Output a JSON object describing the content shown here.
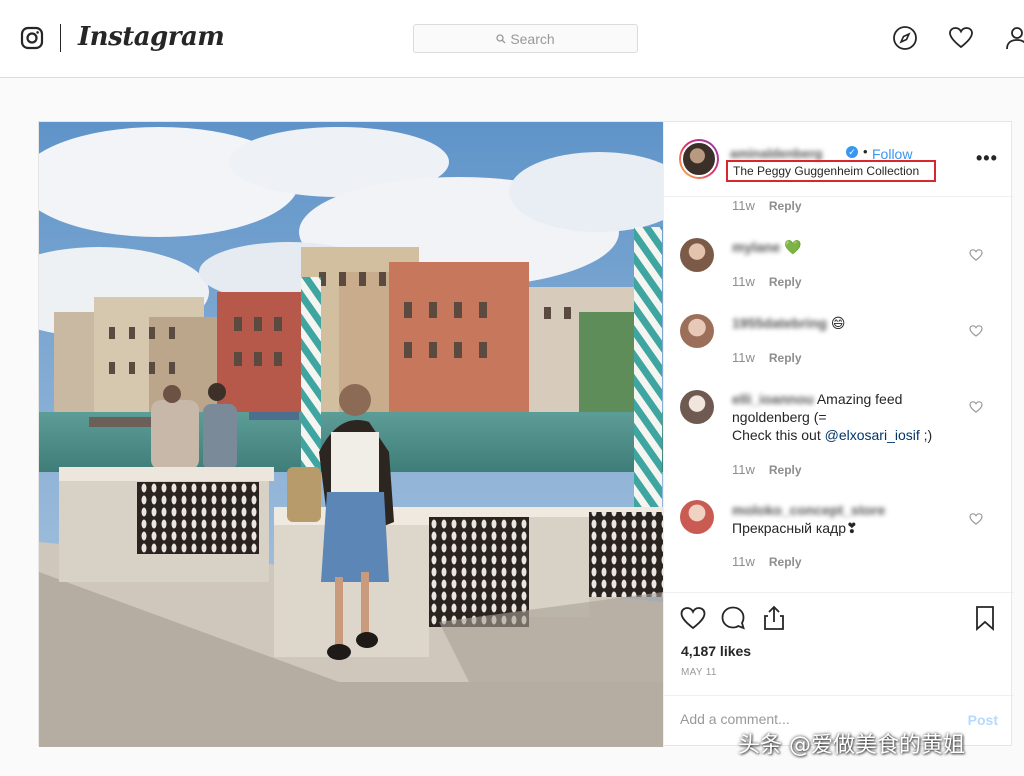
{
  "brand": {
    "wordmark": "Instagram",
    "icon": "instagram-camera-icon"
  },
  "search": {
    "placeholder": "Search",
    "icon": "search-icon"
  },
  "nav_icons": [
    "explore-compass-icon",
    "activity-heart-icon",
    "profile-person-icon"
  ],
  "post": {
    "author": {
      "username": "aminaldenberg",
      "verified": true,
      "follow_label": "Follow"
    },
    "separator": "•",
    "location": "The Peggy Guggenheim Collection",
    "location_highlight_color": "#d9262c",
    "more_label": "•••",
    "comments": [
      {
        "username": "",
        "text": "",
        "time": "11w",
        "reply": "Reply"
      },
      {
        "username": "mylane",
        "text": "💚",
        "time": "11w",
        "reply": "Reply"
      },
      {
        "username": "1955datebring",
        "text": "😄",
        "time": "11w",
        "reply": "Reply"
      },
      {
        "username": "elli_ioannou",
        "text": "Amazing feed ngoldenberg (=",
        "text2": "Check this out ",
        "mention": "@elxosari_iosif",
        "text3": " ;)",
        "time": "11w",
        "reply": "Reply"
      },
      {
        "username": "moloko_concept_store",
        "text": "Прекрасный кадр❣",
        "time": "11w",
        "reply": "Reply"
      }
    ],
    "likes": "4,187 likes",
    "date": "MAY 11",
    "add_comment_placeholder": "Add a comment...",
    "post_label": "Post"
  },
  "watermark": "头条 @爱做美食的黄姐",
  "colors": {
    "link_blue": "#3897f0",
    "border": "#dbdbdb",
    "muted": "#8e8e8e"
  }
}
